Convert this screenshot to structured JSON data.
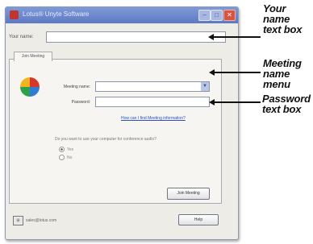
{
  "window": {
    "title": "Lotus® Unyte Software",
    "minimize_glyph": "–",
    "maximize_glyph": "□",
    "close_glyph": "✕",
    "accent": "#5d79c4"
  },
  "your_name": {
    "label": "Your name:",
    "value": ""
  },
  "tab": {
    "label": "Join Meeting"
  },
  "meeting": {
    "label": "Meeting name:",
    "value": "",
    "arrow": "▼"
  },
  "password": {
    "label": "Password:",
    "value": ""
  },
  "help_link": "How can I find Meeting information?",
  "audio": {
    "question": "Do you want to use your computer for conference audio?",
    "yes_label": "Yes",
    "no_label": "No",
    "selected": "Yes"
  },
  "join_button": "Join Meeting",
  "footer": {
    "icon_glyph": "⊞",
    "text": "sales@lotus.com",
    "help_button": "Help"
  },
  "callouts": {
    "name": [
      "Your",
      "name",
      "text box"
    ],
    "meeting": [
      "Meeting",
      "name",
      "menu"
    ],
    "password": [
      "Password",
      "text box"
    ]
  }
}
